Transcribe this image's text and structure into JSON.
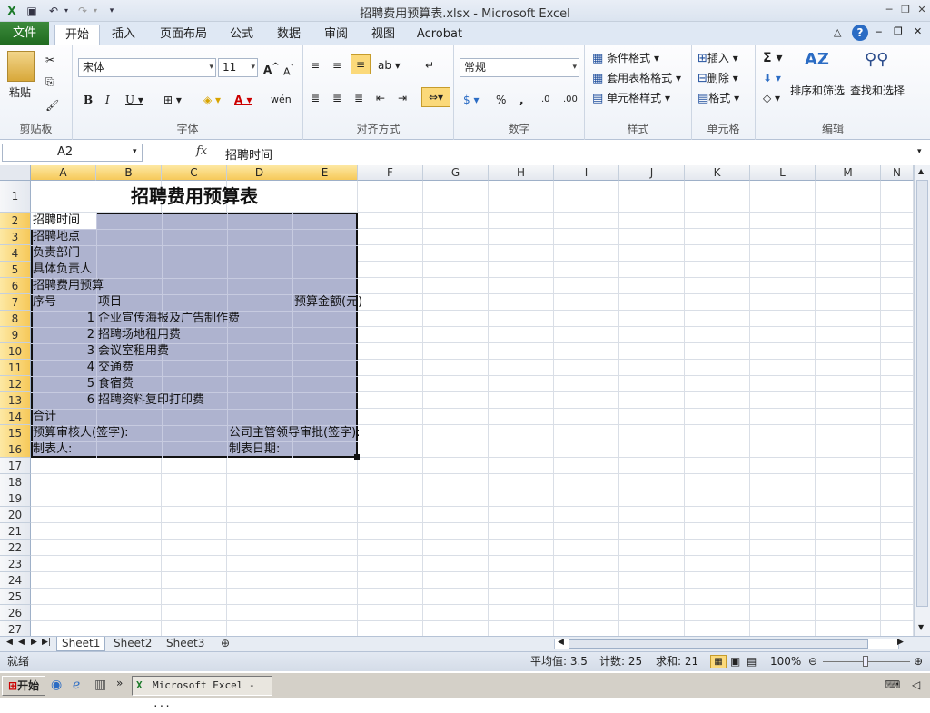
{
  "window": {
    "title": "招聘费用预算表.xlsx - Microsoft Excel"
  },
  "tabs": [
    "文件",
    "开始",
    "插入",
    "页面布局",
    "公式",
    "数据",
    "审阅",
    "视图",
    "Acrobat"
  ],
  "ribbon": {
    "clipboard": {
      "paste": "粘贴",
      "group": "剪贴板"
    },
    "font": {
      "name": "宋体",
      "size": "11",
      "group": "字体",
      "wen": "wén"
    },
    "align": {
      "group": "对齐方式"
    },
    "number": {
      "format": "常规",
      "group": "数字"
    },
    "styles": {
      "cond": "条件格式",
      "table": "套用表格格式",
      "cell": "单元格样式",
      "group": "样式"
    },
    "cells": {
      "insert": "插入",
      "delete": "删除",
      "format": "格式",
      "group": "单元格"
    },
    "edit": {
      "sort": "排序和筛选",
      "find": "查找和选择",
      "group": "编辑"
    }
  },
  "formula": {
    "namebox": "A2",
    "fx": "fx",
    "content": "招聘时间"
  },
  "columns": [
    "A",
    "B",
    "C",
    "D",
    "E",
    "F",
    "G",
    "H",
    "I",
    "J",
    "K",
    "L",
    "M",
    "N"
  ],
  "rows": [
    "1",
    "2",
    "3",
    "4",
    "5",
    "6",
    "7",
    "8",
    "9",
    "10",
    "11",
    "12",
    "13",
    "14",
    "15",
    "16",
    "17",
    "18",
    "19",
    "20",
    "21",
    "22",
    "23",
    "24",
    "25",
    "26",
    "27"
  ],
  "sheet": {
    "title": "招聘费用预算表",
    "r2": "招聘时间",
    "r3": "招聘地点",
    "r4": "负责部门",
    "r5": "具体负责人",
    "r6": "招聘费用预算",
    "r7a": "序号",
    "r7b": "项目",
    "r7e": "预算金额(元)",
    "items": [
      {
        "no": "1",
        "name": "企业宣传海报及广告制作费"
      },
      {
        "no": "2",
        "name": "招聘场地租用费"
      },
      {
        "no": "3",
        "name": "会议室租用费"
      },
      {
        "no": "4",
        "name": "交通费"
      },
      {
        "no": "5",
        "name": "食宿费"
      },
      {
        "no": "6",
        "name": "招聘资料复印打印费"
      }
    ],
    "r14": "合计",
    "r15a": "预算审核人(签字):",
    "r15d": "公司主管领导审批(签字):",
    "r16a": "制表人:",
    "r16d": "制表日期:"
  },
  "sheets": [
    "Sheet1",
    "Sheet2",
    "Sheet3"
  ],
  "status": {
    "ready": "就绪",
    "avg": "平均值: 3.5",
    "count": "计数: 25",
    "sum": "求和: 21",
    "zoom": "100%"
  },
  "taskbar": {
    "start": "开始",
    "task": "Microsoft Excel - ..."
  }
}
